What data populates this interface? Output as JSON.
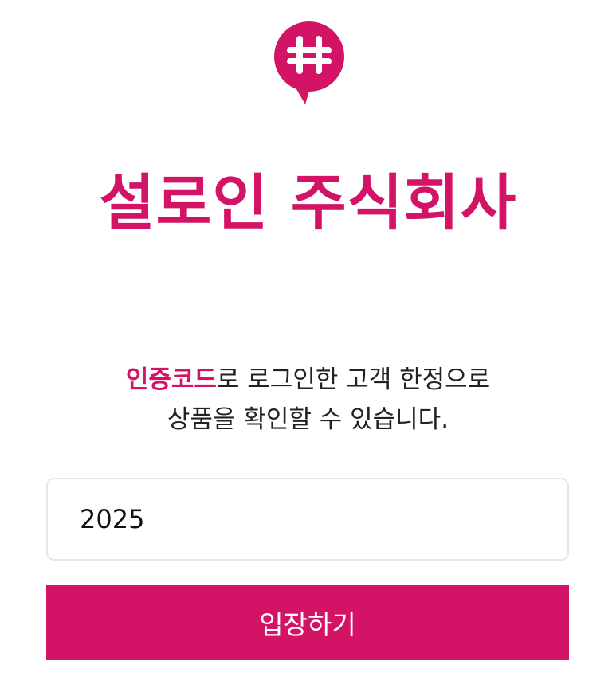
{
  "brand": {
    "logo_icon": "hash-speech-bubble-icon",
    "title": "설로인 주식회사"
  },
  "notice": {
    "highlight": "인증코드",
    "line1_rest": "로 로그인한 고객 한정으로",
    "line2": "상품을 확인할 수 있습니다."
  },
  "login": {
    "code_value": "2025",
    "button_label": "입장하기"
  },
  "colors": {
    "accent": "#d31466",
    "text": "#222222",
    "input_border": "#e6e6e6"
  }
}
